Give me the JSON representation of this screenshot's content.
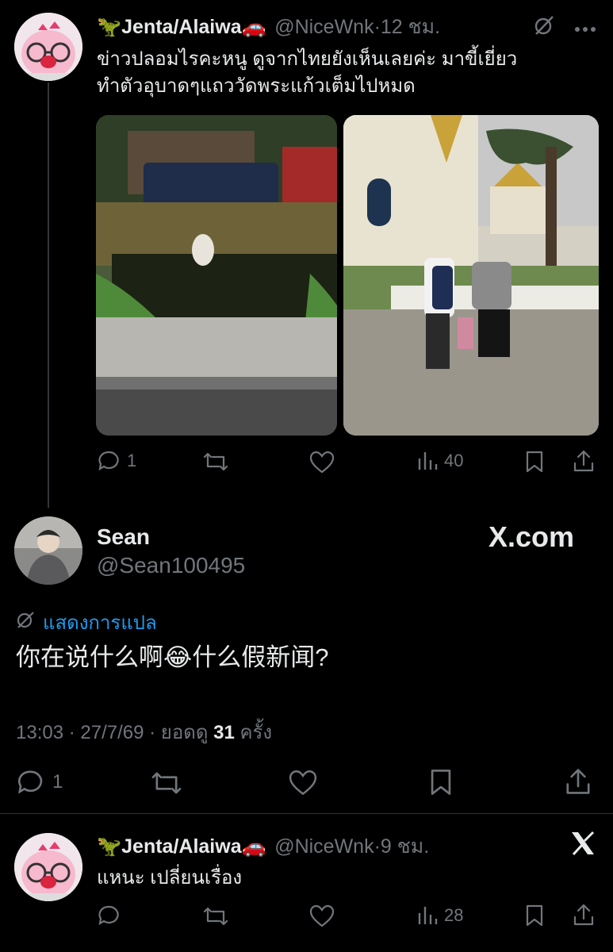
{
  "tweet1": {
    "name": "Jenta/Alaiwa",
    "name_emoji_left": "🦖",
    "name_emoji_right": "🚗",
    "handle": "@NiceWnk",
    "separator": "·",
    "time": "12 ชม.",
    "text_line1": "ข่าวปลอมไรคะหนู ดูจากไทยยังเห็นเลยค่ะ มาขี้เยี่ยว",
    "text_line2": "ทำตัวอุบาดๆแถววัดพระแก้วเต็มไปหมด",
    "replies": "1",
    "views": "40"
  },
  "quoted": {
    "name": "Sean",
    "handle": "@Sean100495",
    "brand": "X.com",
    "translate_label": "แสดงการแปล",
    "text_before": "你在说什么啊",
    "emoji": "😂",
    "text_after": "什么假新闻?",
    "meta_time": "13:03 · 27/7/69 · ยอดดู ",
    "meta_views": "31",
    "meta_suffix": " ครั้ง",
    "replies": "1"
  },
  "tweet2": {
    "name": "Jenta/Alaiwa",
    "name_emoji_left": "🦖",
    "name_emoji_right": "🚗",
    "handle": "@NiceWnk",
    "separator": "·",
    "time": "9 ชม.",
    "text": "แหนะ เปลี่ยนเรื่อง",
    "views": "28"
  },
  "colors": {
    "background": "#000000",
    "text": "#e7e9ea",
    "secondary": "#71767b",
    "link": "#1d9bf0"
  }
}
